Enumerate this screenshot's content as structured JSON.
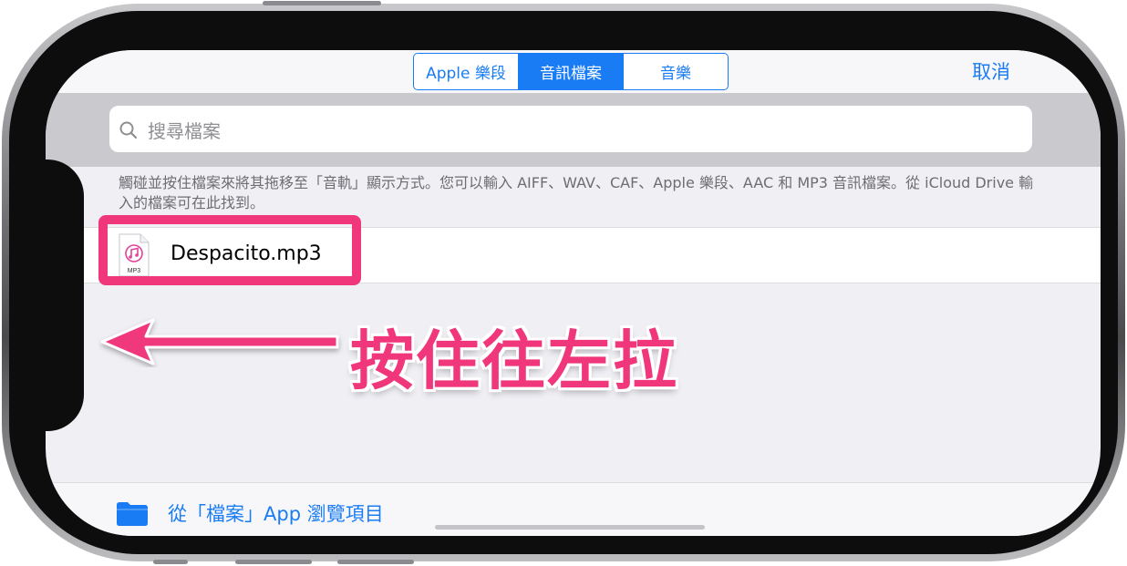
{
  "segmented_control": {
    "tabs": [
      {
        "label": "Apple 樂段",
        "active": false
      },
      {
        "label": "音訊檔案",
        "active": true
      },
      {
        "label": "音樂",
        "active": false
      }
    ]
  },
  "navbar": {
    "cancel_label": "取消"
  },
  "search": {
    "placeholder": "搜尋檔案",
    "icon": "search-icon"
  },
  "hint": {
    "text": "觸碰並按住檔案來將其拖移至「音軌」顯示方式。您可以輸入 AIFF、WAV、CAF、Apple 樂段、AAC 和 MP3 音訊檔案。從 iCloud Drive 輸入的檔案可在此找到。"
  },
  "files": [
    {
      "name": "Despacito.mp3",
      "type_label": "MP3",
      "icon": "music-file-icon"
    }
  ],
  "annotation": {
    "text": "按住往左拉",
    "color": "#f0377b"
  },
  "bottom": {
    "browse_label": "從「檔案」App 瀏覽項目",
    "icon": "folder-icon"
  },
  "colors": {
    "accent": "#1a7cf4",
    "annotation": "#f0377b"
  }
}
